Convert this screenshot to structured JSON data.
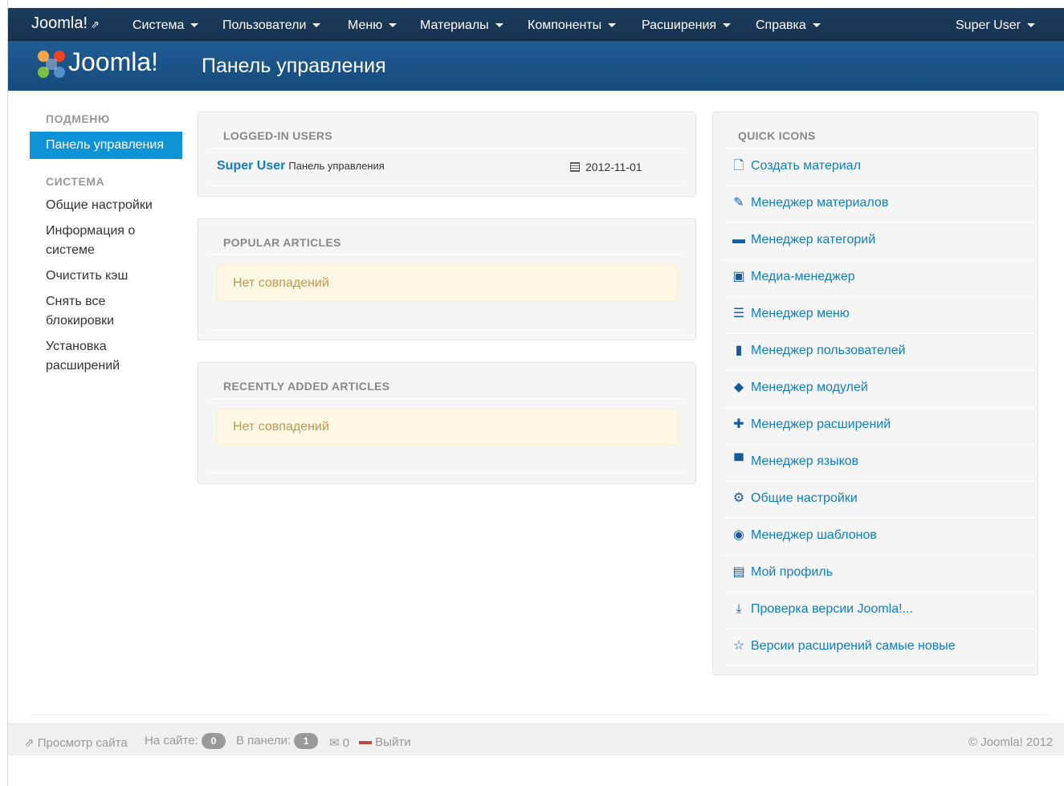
{
  "navbar": {
    "brand": "Joomla!",
    "brand_icon": "external-link-icon",
    "menus": [
      {
        "label": "Система"
      },
      {
        "label": "Пользователи"
      },
      {
        "label": "Меню"
      },
      {
        "label": "Материалы"
      },
      {
        "label": "Компоненты"
      },
      {
        "label": "Расширения"
      },
      {
        "label": "Справка"
      }
    ],
    "user": "Super User"
  },
  "header": {
    "logo_text": "Joomla!",
    "title": "Панель управления"
  },
  "sidebar": {
    "submenu_heading": "ПОДМЕНЮ",
    "active_item": "Панель управления",
    "system_heading": "СИСТЕМА",
    "items": [
      {
        "label": "Общие настройки"
      },
      {
        "label": "Информация о системе"
      },
      {
        "label": "Очистить кэш"
      },
      {
        "label": "Снять все блокировки"
      },
      {
        "label": "Установка расширений"
      }
    ]
  },
  "logged_in": {
    "heading": "LOGGED-IN USERS",
    "user": "Super User",
    "place": "Панель управления",
    "date": "2012-11-01"
  },
  "popular": {
    "heading": "POPULAR ARTICLES",
    "empty": "Нет совпадений"
  },
  "recent": {
    "heading": "RECENTLY ADDED ARTICLES",
    "empty": "Нет совпадений"
  },
  "quick_icons": {
    "heading": "QUICK ICONS",
    "items": [
      {
        "label": "Создать материал",
        "icon": "new-document-icon"
      },
      {
        "label": "Менеджер материалов",
        "icon": "pencil-icon"
      },
      {
        "label": "Менеджер категорий",
        "icon": "folder-icon"
      },
      {
        "label": "Медиа-менеджер",
        "icon": "image-icon"
      },
      {
        "label": "Менеджер меню",
        "icon": "list-icon"
      },
      {
        "label": "Менеджер пользователей",
        "icon": "address-book-icon"
      },
      {
        "label": "Менеджер модулей",
        "icon": "cube-icon"
      },
      {
        "label": "Менеджер расширений",
        "icon": "puzzle-icon"
      },
      {
        "label": "Менеджер языков",
        "icon": "comments-icon"
      },
      {
        "label": "Общие настройки",
        "icon": "cog-icon"
      },
      {
        "label": "Менеджер шаблонов",
        "icon": "eye-icon"
      },
      {
        "label": "Мой профиль",
        "icon": "vcard-icon"
      },
      {
        "label": "Проверка версии Joomla!...",
        "icon": "download-icon"
      },
      {
        "label": "Версии расширений самые новые",
        "icon": "star-icon"
      }
    ]
  },
  "footer": {
    "view_site": "Просмотр сайта",
    "on_site_label": "На сайте:",
    "on_site_count": "0",
    "in_panel_label": "В панели:",
    "in_panel_count": "1",
    "messages_count": "0",
    "logout": "Выйти",
    "copyright": "© Joomla! 2012"
  },
  "colors": {
    "navbar": "#1c3d5f",
    "header": "#1f5c95",
    "accent": "#0e93d6",
    "link": "#0e7ec4",
    "alert_bg": "#fcf8e3",
    "alert_text": "#c09853"
  }
}
